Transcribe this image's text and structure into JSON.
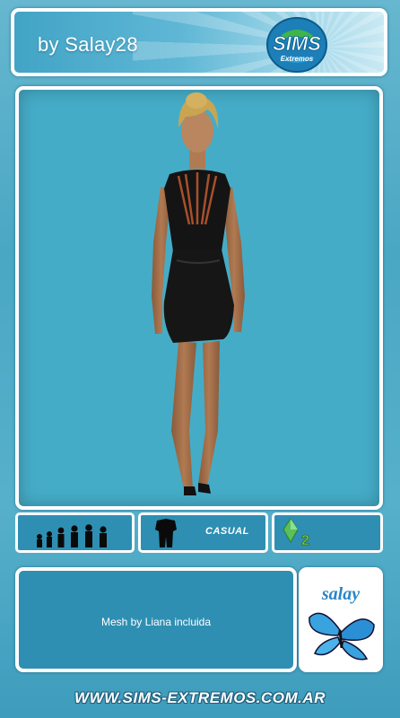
{
  "header": {
    "byline": "by Salay28",
    "logo_main": "SIMS",
    "logo_sub": "Extremos"
  },
  "ages_icon": "age-group-silhouettes-icon",
  "category": {
    "icon": "outfit-silhouette-icon",
    "label": "CASUAL"
  },
  "expansion": {
    "icon": "sims2-plumbob-icon",
    "label": "2"
  },
  "footer": {
    "mesh_note": "Mesh by Liana incluida",
    "badge_text": "salay",
    "badge_icon": "butterfly-icon"
  },
  "site_url": "WWW.SIMS-EXTREMOS.COM.AR",
  "colors": {
    "panel_bg": "#45acc7",
    "cell_bg": "#2e8fb3",
    "border": "#ffffff"
  }
}
